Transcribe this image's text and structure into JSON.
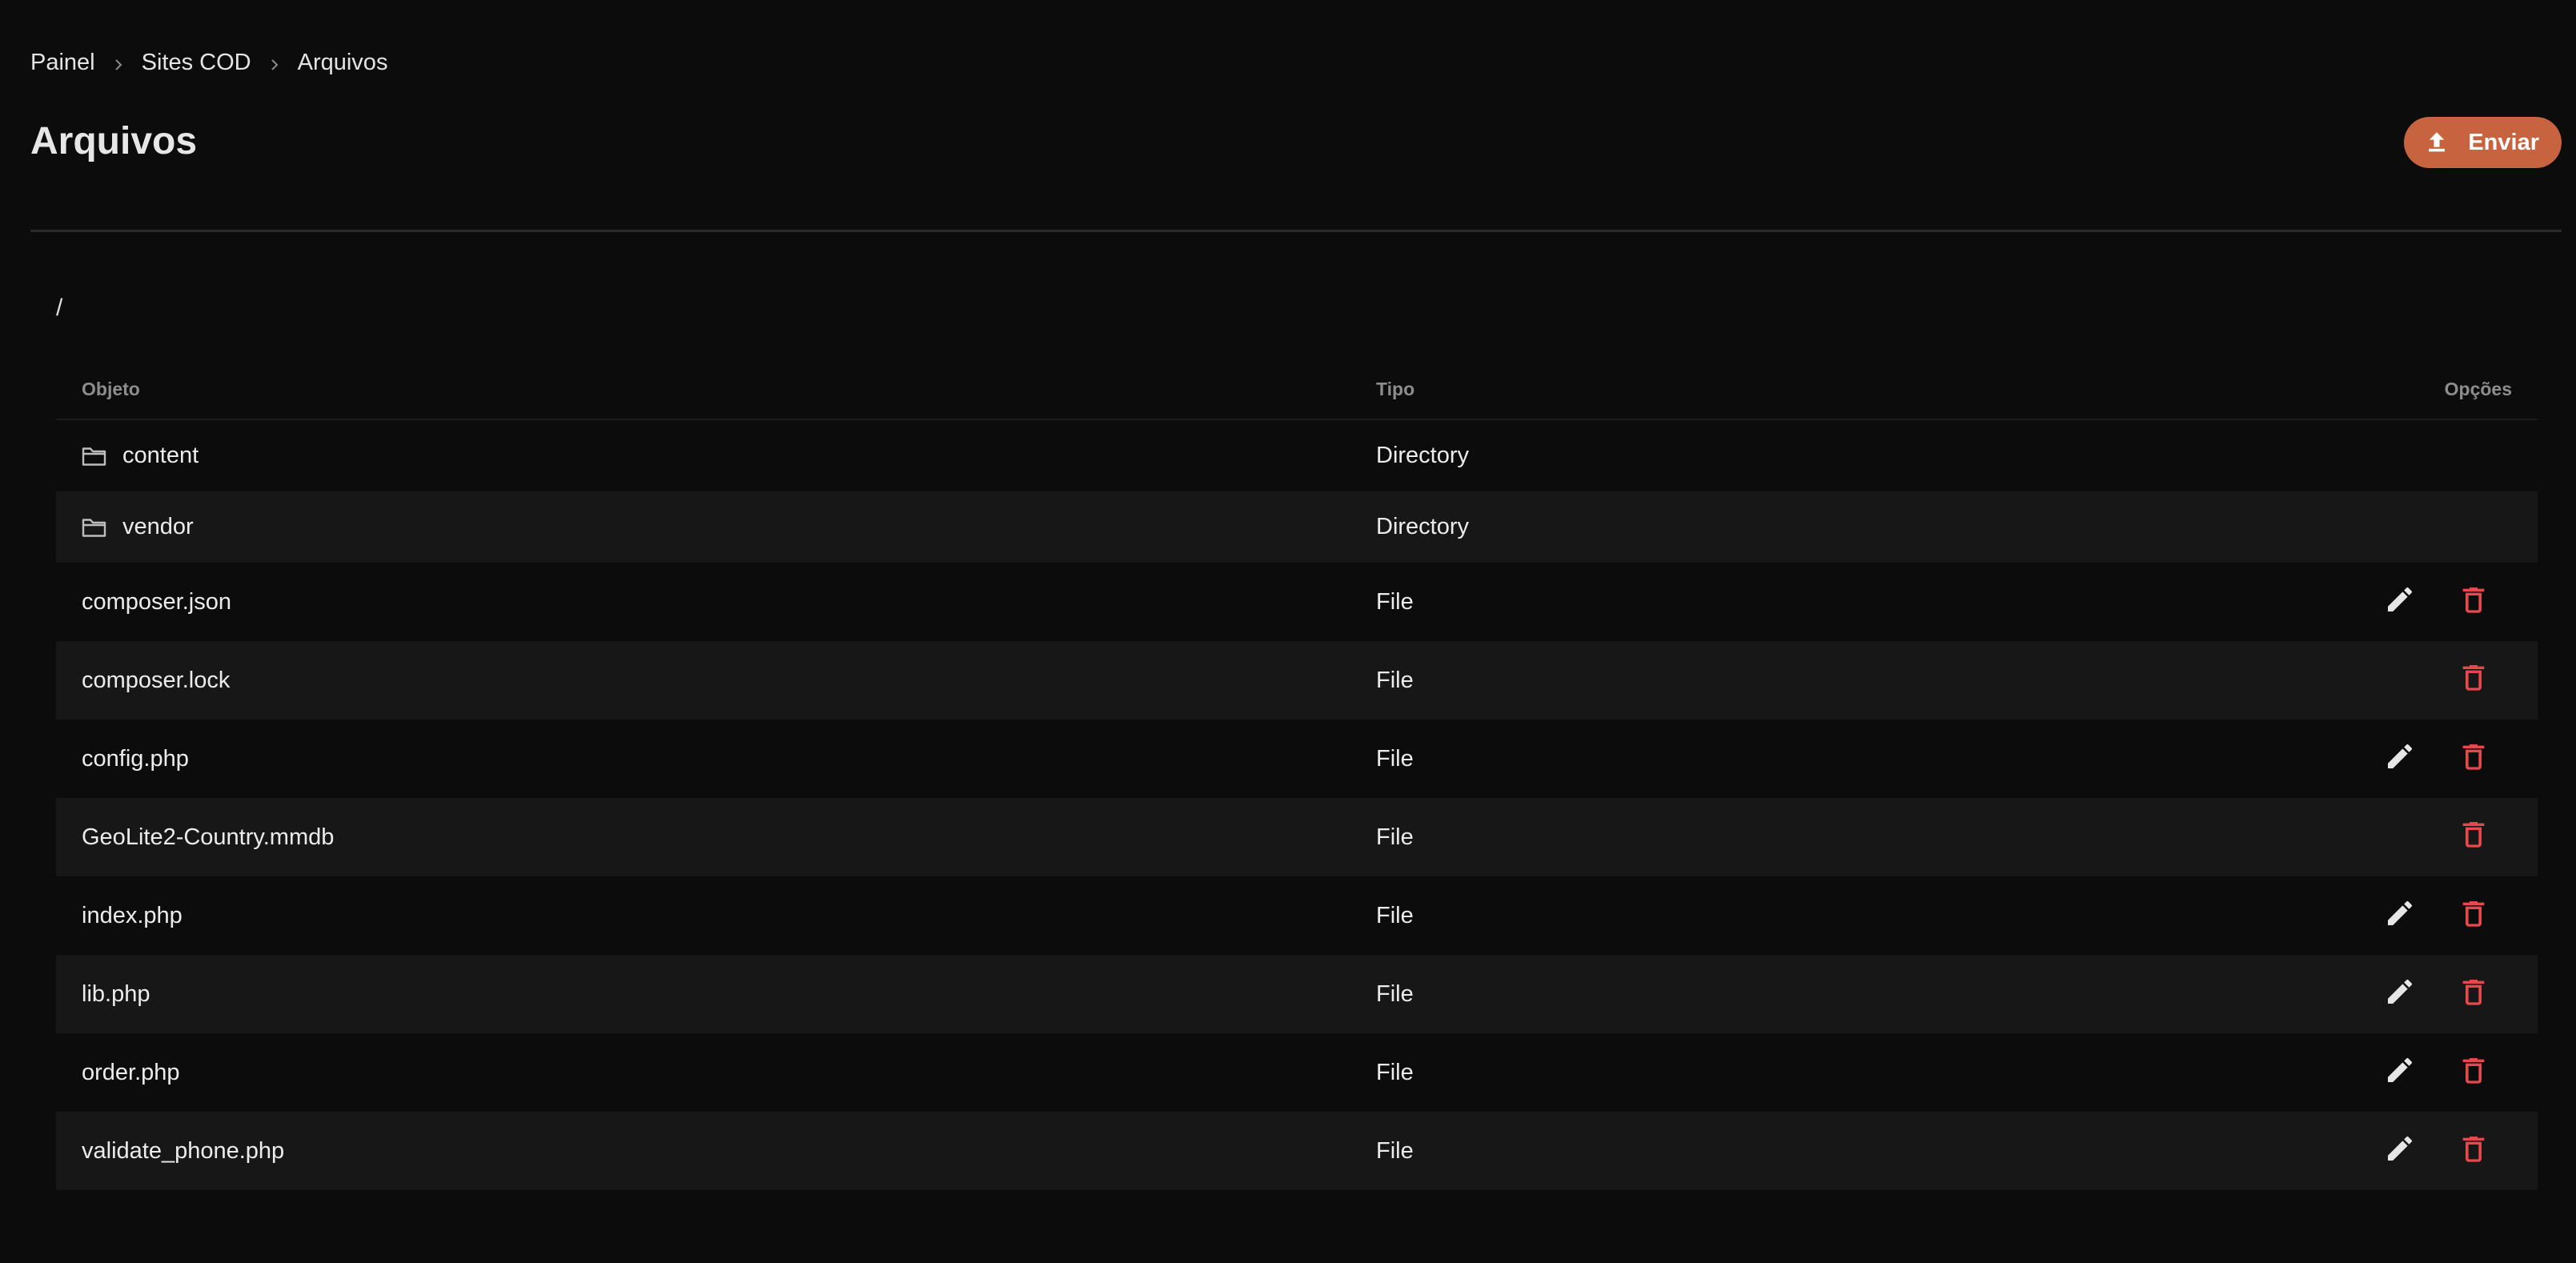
{
  "breadcrumb": {
    "items": [
      "Painel",
      "Sites COD",
      "Arquivos"
    ]
  },
  "header": {
    "title": "Arquivos",
    "upload_label": "Enviar"
  },
  "path": "/",
  "table": {
    "columns": {
      "object": "Objeto",
      "type": "Tipo",
      "options": "Opções"
    },
    "rows": [
      {
        "name": "content",
        "type": "Directory",
        "is_dir": true,
        "editable": false,
        "deletable": false
      },
      {
        "name": "vendor",
        "type": "Directory",
        "is_dir": true,
        "editable": false,
        "deletable": false
      },
      {
        "name": "composer.json",
        "type": "File",
        "is_dir": false,
        "editable": true,
        "deletable": true
      },
      {
        "name": "composer.lock",
        "type": "File",
        "is_dir": false,
        "editable": false,
        "deletable": true
      },
      {
        "name": "config.php",
        "type": "File",
        "is_dir": false,
        "editable": true,
        "deletable": true
      },
      {
        "name": "GeoLite2-Country.mmdb",
        "type": "File",
        "is_dir": false,
        "editable": false,
        "deletable": true
      },
      {
        "name": "index.php",
        "type": "File",
        "is_dir": false,
        "editable": true,
        "deletable": true
      },
      {
        "name": "lib.php",
        "type": "File",
        "is_dir": false,
        "editable": true,
        "deletable": true
      },
      {
        "name": "order.php",
        "type": "File",
        "is_dir": false,
        "editable": true,
        "deletable": true
      },
      {
        "name": "validate_phone.php",
        "type": "File",
        "is_dir": false,
        "editable": true,
        "deletable": true
      }
    ]
  },
  "colors": {
    "background": "#0c0c0c",
    "row_alt": "#171717",
    "accent": "#c7633f",
    "delete": "#e5484d",
    "edit": "#e6e6e6"
  },
  "icons": {
    "folder": "folder-icon",
    "edit": "pencil-icon",
    "delete": "trash-icon",
    "upload": "upload-icon",
    "separator": "chevron-right-icon"
  }
}
